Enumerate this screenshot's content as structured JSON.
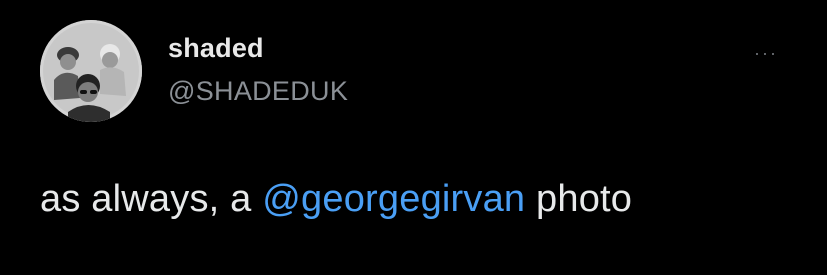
{
  "tweet": {
    "author": {
      "display_name": "shaded",
      "handle": "@SHADEDUK",
      "avatar_icon": "band-photo-avatar"
    },
    "more_icon": "more-options-icon",
    "more_label": "···",
    "text_parts": {
      "before": "as always, a ",
      "mention": "@georgegirvan",
      "after": " photo"
    }
  },
  "colors": {
    "background": "#000000",
    "text": "#e7e9ea",
    "muted": "#8b9096",
    "link": "#4a9ff5"
  }
}
